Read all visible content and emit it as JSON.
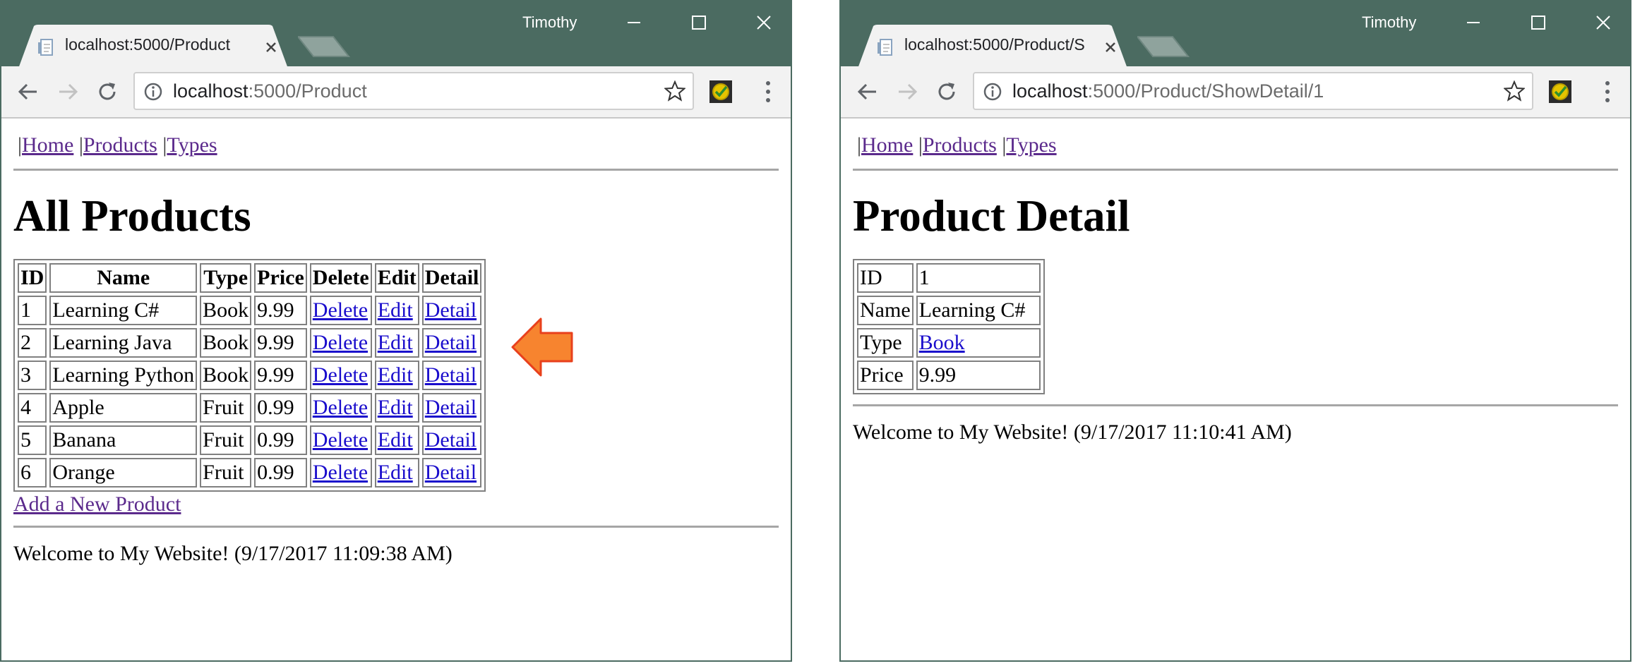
{
  "left_window": {
    "user": "Timothy",
    "tab_title": "localhost:5000/Product",
    "url_host": "localhost",
    "url_rest": ":5000/Product",
    "nav_links": [
      "Home",
      "Products",
      "Types"
    ],
    "heading": "All Products",
    "table": {
      "headers": [
        "ID",
        "Name",
        "Type",
        "Price",
        "Delete",
        "Edit",
        "Detail"
      ],
      "rows": [
        {
          "id": "1",
          "name": "Learning C#",
          "type": "Book",
          "price": "9.99",
          "delete": "Delete",
          "edit": "Edit",
          "detail": "Detail"
        },
        {
          "id": "2",
          "name": "Learning Java",
          "type": "Book",
          "price": "9.99",
          "delete": "Delete",
          "edit": "Edit",
          "detail": "Detail"
        },
        {
          "id": "3",
          "name": "Learning Python",
          "type": "Book",
          "price": "9.99",
          "delete": "Delete",
          "edit": "Edit",
          "detail": "Detail"
        },
        {
          "id": "4",
          "name": "Apple",
          "type": "Fruit",
          "price": "0.99",
          "delete": "Delete",
          "edit": "Edit",
          "detail": "Detail"
        },
        {
          "id": "5",
          "name": "Banana",
          "type": "Fruit",
          "price": "0.99",
          "delete": "Delete",
          "edit": "Edit",
          "detail": "Detail"
        },
        {
          "id": "6",
          "name": "Orange",
          "type": "Fruit",
          "price": "0.99",
          "delete": "Delete",
          "edit": "Edit",
          "detail": "Detail"
        }
      ]
    },
    "add_link": "Add a New Product",
    "footer": "Welcome to My Website! (9/17/2017 11:09:38 AM)"
  },
  "right_window": {
    "user": "Timothy",
    "tab_title": "localhost:5000/Product/S",
    "url_host": "localhost",
    "url_rest": ":5000/Product/ShowDetail/1",
    "nav_links": [
      "Home",
      "Products",
      "Types"
    ],
    "heading": "Product Detail",
    "detail": [
      {
        "label": "ID",
        "value": "1"
      },
      {
        "label": "Name",
        "value": "Learning C#"
      },
      {
        "label": "Type",
        "value": "Book"
      },
      {
        "label": "Price",
        "value": "9.99"
      }
    ],
    "footer": "Welcome to My Website! (9/17/2017 11:10:41 AM)"
  },
  "colors": {
    "titlebar": "#4b6b61",
    "visited_link": "#5b2a8c",
    "link": "#1a0dcc",
    "arrow_fill": "#f7842f",
    "arrow_stroke": "#e8401c"
  },
  "icons": [
    "page-icon",
    "close-icon",
    "back-icon",
    "forward-icon",
    "reload-icon",
    "info-icon",
    "star-icon",
    "extension-icon",
    "menu-icon",
    "minimize-icon",
    "maximize-icon",
    "window-close-icon",
    "arrow-pointer-icon"
  ]
}
